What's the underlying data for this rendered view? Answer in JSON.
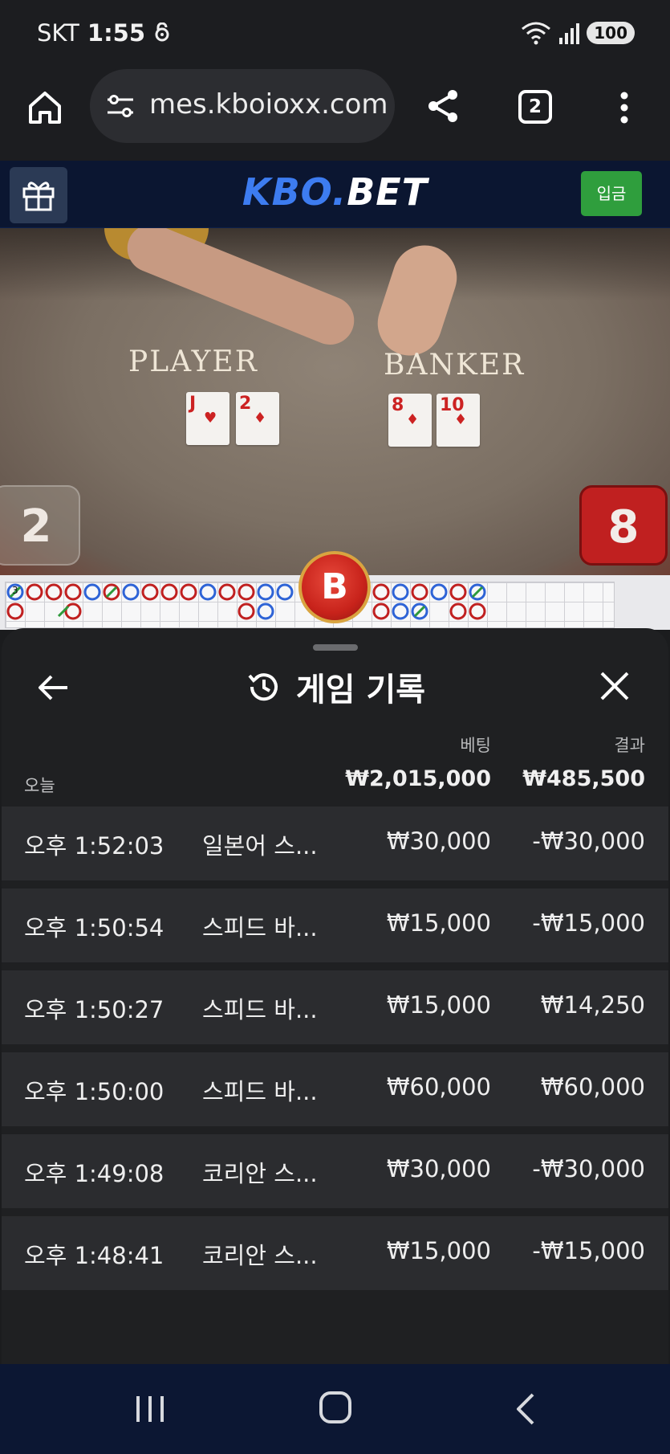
{
  "status_bar": {
    "carrier": "SKT",
    "time": "1:55",
    "battery": "100"
  },
  "browser": {
    "url": "mes.kboioxx.com",
    "tab_count": "2",
    "icons": [
      "home-icon",
      "site-settings-icon",
      "share-icon",
      "tabs-icon",
      "more-vert-icon"
    ]
  },
  "site_header": {
    "logo_left": "KBO.",
    "logo_right": "BET",
    "deposit_label": "입금"
  },
  "game_view": {
    "player_label": "PLAYER",
    "banker_label": "BANKER",
    "player_score": "2",
    "banker_score": "8",
    "player_cards": [
      {
        "rank": "J",
        "suit": "♥"
      },
      {
        "rank": "2",
        "suit": "♦"
      }
    ],
    "banker_cards": [
      {
        "rank": "8",
        "suit": "♦"
      },
      {
        "rank": "10",
        "suit": "♦"
      }
    ],
    "road_count": "3",
    "result_badge": "B"
  },
  "history_sheet": {
    "title": "게임 기록",
    "header_bet": "베팅",
    "header_result": "결과",
    "today_label": "오늘",
    "total_bet": "₩2,015,000",
    "total_result": "₩485,500",
    "rows": [
      {
        "time": "오후 1:52:03",
        "game": "일본어 스...",
        "bet": "₩30,000",
        "result": "-₩30,000"
      },
      {
        "time": "오후 1:50:54",
        "game": "스피드 바...",
        "bet": "₩15,000",
        "result": "-₩15,000"
      },
      {
        "time": "오후 1:50:27",
        "game": "스피드 바...",
        "bet": "₩15,000",
        "result": "₩14,250"
      },
      {
        "time": "오후 1:50:00",
        "game": "스피드 바...",
        "bet": "₩60,000",
        "result": "₩60,000"
      },
      {
        "time": "오후 1:49:08",
        "game": "코리안 스...",
        "bet": "₩30,000",
        "result": "-₩30,000"
      },
      {
        "time": "오후 1:48:41",
        "game": "코리안 스...",
        "bet": "₩15,000",
        "result": "-₩15,000"
      }
    ]
  },
  "colors": {
    "brand_blue": "#3d7cf0",
    "deposit_green": "#2f9e3d",
    "banker_red": "#c02020",
    "player_blue": "#2e63d6"
  }
}
